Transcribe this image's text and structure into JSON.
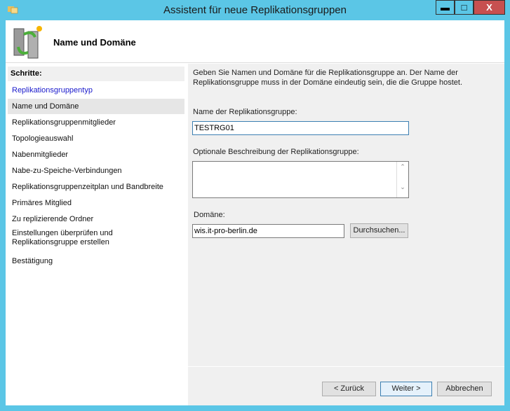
{
  "window": {
    "title": "Assistent für neue Replikationsgruppen",
    "minimize": "▬",
    "maximize": "□",
    "close": "X"
  },
  "header": {
    "title": "Name und Domäne"
  },
  "steps": {
    "heading": "Schritte:",
    "items": [
      {
        "label": "Replikationsgruppentyp",
        "state": "link"
      },
      {
        "label": "Name und Domäne",
        "state": "selected"
      },
      {
        "label": "Replikationsgruppenmitglieder"
      },
      {
        "label": "Topologieauswahl"
      },
      {
        "label": "Nabenmitglieder"
      },
      {
        "label": "Nabe-zu-Speiche-Verbindungen"
      },
      {
        "label": "Replikationsgruppenzeitplan und Bandbreite"
      },
      {
        "label": "Primäres Mitglied"
      },
      {
        "label": "Zu replizierende Ordner"
      },
      {
        "label": "Einstellungen überprüfen und Replikationsgruppe erstellen"
      },
      {
        "label": "Bestätigung"
      }
    ]
  },
  "main": {
    "description": "Geben Sie Namen und Domäne für die Replikationsgruppe an. Der Name der Replikationsgruppe muss in der Domäne eindeutig sein, die die Gruppe hostet.",
    "name_label": "Name der Replikationsgruppe:",
    "name_value": "TESTRG01",
    "desc_label": "Optionale Beschreibung der Replikationsgruppe:",
    "desc_value": "",
    "domain_label": "Domäne:",
    "domain_value": "wis.it-pro-berlin.de",
    "browse": "Durchsuchen..."
  },
  "buttons": {
    "back": "< Zurück",
    "next": "Weiter >",
    "cancel": "Abbrechen"
  }
}
